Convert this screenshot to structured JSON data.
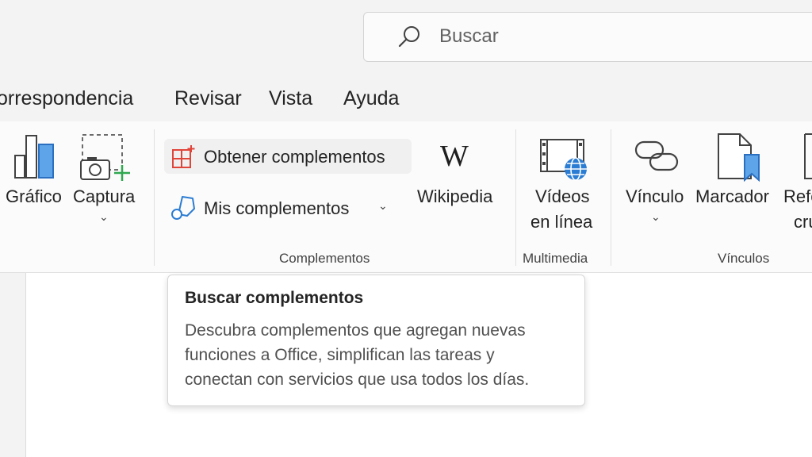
{
  "search": {
    "placeholder": "Buscar",
    "icon": "search-icon"
  },
  "tabs": [
    {
      "label": "orrespondencia"
    },
    {
      "label": "Revisar"
    },
    {
      "label": "Vista"
    },
    {
      "label": "Ayuda"
    }
  ],
  "ribbon": {
    "grafico": {
      "label": "Gráfico",
      "icon": "bar-chart-icon"
    },
    "captura": {
      "label": "Captura",
      "chevron": "⌄",
      "icon": "screenshot-icon"
    },
    "obtener": {
      "label": "Obtener complementos",
      "icon": "get-addins-icon"
    },
    "mis": {
      "label": "Mis complementos",
      "chevron": "⌄",
      "icon": "my-addins-icon"
    },
    "wikipedia": {
      "label": "Wikipedia",
      "icon": "wikipedia-icon",
      "glyph": "W"
    },
    "videos": {
      "line1": "Vídeos",
      "line2": "en línea",
      "icon": "online-video-icon"
    },
    "vinculo": {
      "label": "Vínculo",
      "chevron": "⌄",
      "icon": "link-icon"
    },
    "marcador": {
      "label": "Marcador",
      "icon": "bookmark-icon"
    },
    "referencia": {
      "line1": "Refe",
      "line2": "cru",
      "icon": "cross-reference-icon"
    },
    "groups": {
      "complementos": "Complementos",
      "multimedia": "Multimedia",
      "vinculos": "Vínculos"
    }
  },
  "tooltip": {
    "title": "Buscar complementos",
    "lines": [
      "Descubra complementos que agregan nuevas",
      "funciones a Office, simplifican las tareas y",
      "conectan con servicios que usa todos los días."
    ]
  },
  "colors": {
    "accent": "#2b7cd3",
    "red": "#e0453a",
    "green": "#2fa84f"
  }
}
